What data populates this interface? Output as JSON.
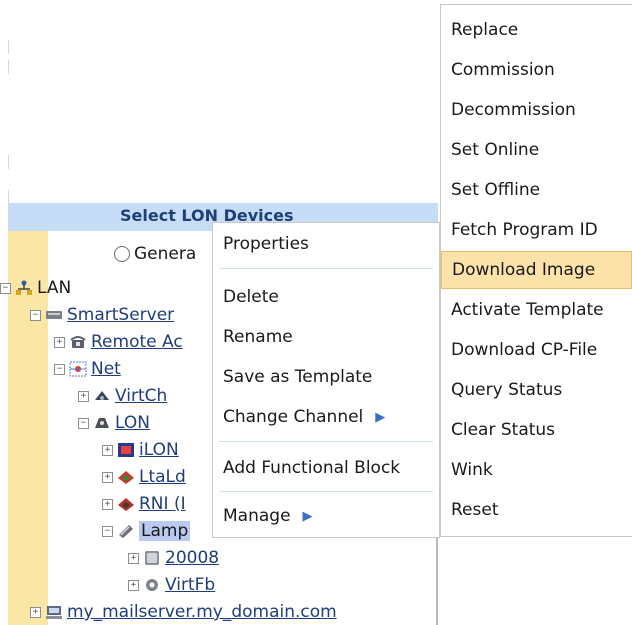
{
  "header_title": "Select LON Devices",
  "radio_label": "Genera",
  "tree": {
    "lan": "LAN",
    "smartserver": "SmartServer",
    "remote": "Remote Ac",
    "net": "Net",
    "virtch": "VirtCh",
    "lon": "LON",
    "ilon": "iLON",
    "ltald": "LtaLd",
    "rni": "RNI (I",
    "lamp": "Lamp",
    "n20008": "20008",
    "virtfb": "VirtFb",
    "mailserver": "my_mailserver.my_domain.com"
  },
  "context_menu": {
    "properties": "Properties",
    "delete": "Delete",
    "rename": "Rename",
    "save_template": "Save as Template",
    "change_channel": "Change Channel",
    "add_fb": "Add Functional Block",
    "manage": "Manage"
  },
  "submenu": {
    "items": [
      "Replace",
      "Commission",
      "Decommission",
      "Set Online",
      "Set Offline",
      "Fetch Program ID",
      "Download Image",
      "Activate Template",
      "Download CP-File",
      "Query Status",
      "Clear Status",
      "Wink",
      "Reset"
    ],
    "highlighted": "Download Image"
  },
  "colors": {
    "header_band": "#c7dcf7",
    "left_strip": "#fbe7a5",
    "highlight": "#fde2aa",
    "selection": "#b9c9ef",
    "link": "#1f3d7a"
  },
  "icons": [
    "network-icon",
    "server-icon",
    "telephone-icon",
    "net-icon",
    "router-icon",
    "lon-icon",
    "device-icon",
    "lamp-icon",
    "chevron-right-icon"
  ]
}
